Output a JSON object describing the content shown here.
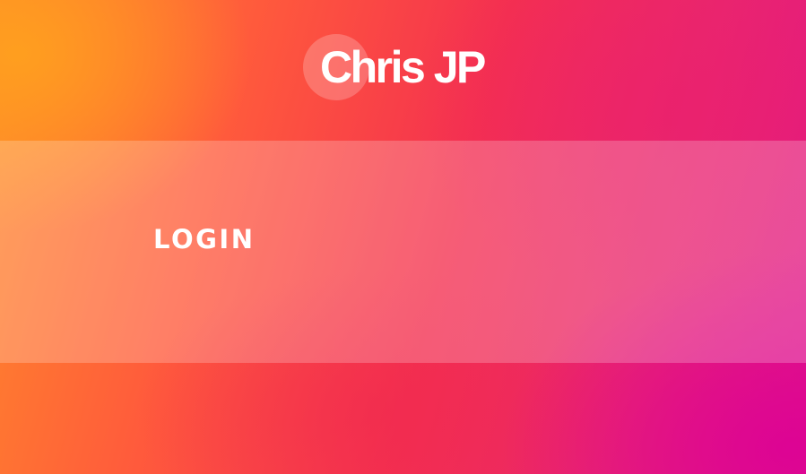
{
  "header": {
    "logo_text": "Chris JP"
  },
  "main": {
    "login_label": "LOGIN"
  }
}
